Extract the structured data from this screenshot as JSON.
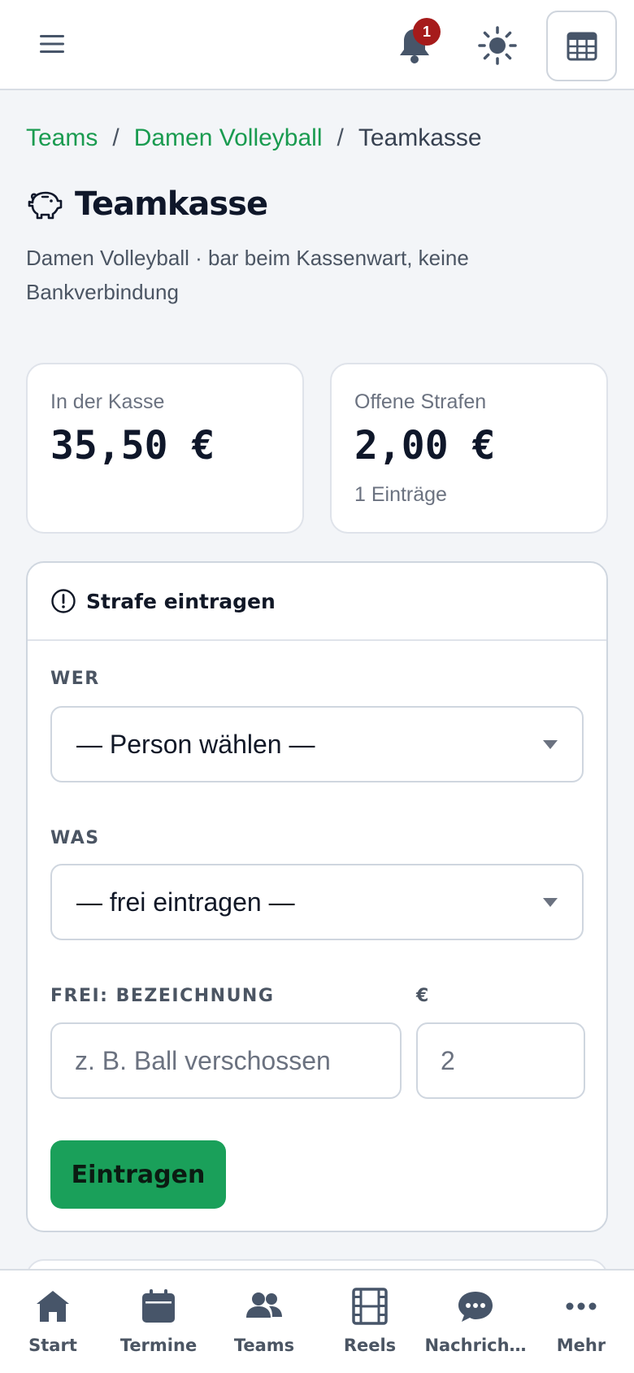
{
  "topbar": {
    "notification_count": "1"
  },
  "breadcrumb": {
    "items": [
      "Teams",
      "Damen Volleyball",
      "Teamkasse"
    ],
    "separator": "/"
  },
  "page": {
    "title": "Teamkasse",
    "subtitle": "Damen Volleyball · bar beim Kassenwart, keine Bankverbindung"
  },
  "stats": {
    "cash": {
      "label": "In der Kasse",
      "value": "35,50 €"
    },
    "open_fines": {
      "label": "Offene Strafen",
      "value": "2,00 €",
      "sub": "1 Einträge"
    }
  },
  "form": {
    "header": "Strafe eintragen",
    "who_label": "WER",
    "who_value": "— Person wählen —",
    "what_label": "WAS",
    "what_value": "— frei eintragen —",
    "free_label": "FREI: BEZEICHNUNG",
    "free_placeholder": "z. B. Ball verschossen",
    "amount_label": "€",
    "amount_placeholder": "2",
    "submit_label": "Eintragen"
  },
  "bottom_nav": {
    "items": [
      {
        "label": "Start",
        "icon": "home-icon"
      },
      {
        "label": "Termine",
        "icon": "calendar-icon"
      },
      {
        "label": "Teams",
        "icon": "users-icon"
      },
      {
        "label": "Reels",
        "icon": "film-icon"
      },
      {
        "label": "Nachrich…",
        "icon": "chat-icon"
      },
      {
        "label": "Mehr",
        "icon": "more-icon"
      }
    ]
  },
  "colors": {
    "accent": "#1aa05a",
    "link": "#1a9b50",
    "badge": "#a61b1b",
    "icon": "#475569"
  }
}
